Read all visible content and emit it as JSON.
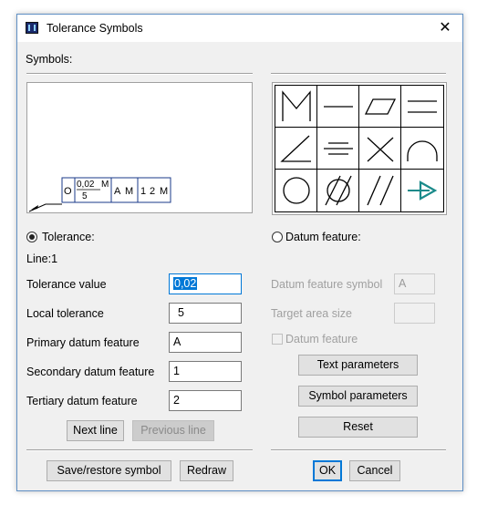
{
  "window": {
    "title": "Tolerance Symbols",
    "close_glyph": "✕"
  },
  "symbols_label": "Symbols:",
  "preview": {
    "circle_symbol": "O",
    "value_top": "0,02",
    "value_top_modifier": "M",
    "value_bottom": "5",
    "datum_a": "A",
    "datum_a_modifier": "M",
    "datum_b": "1",
    "datum_c": "2",
    "datum_c_modifier": "M"
  },
  "palette": {
    "symbols": [
      "max-material-icon",
      "straightness-icon",
      "flatness-icon",
      "parallelism-icon",
      "angularity-icon",
      "symmetry-icon",
      "position-icon",
      "profile-line-icon",
      "circularity-icon",
      "cylindricity-icon",
      "total-runout-icon",
      "circular-runout-icon"
    ],
    "arrow_color": "#1a8a8a"
  },
  "tolerance": {
    "radio_label": "Tolerance:",
    "line_label": "Line:1",
    "fields": [
      {
        "label": "Tolerance value",
        "value": "0,02"
      },
      {
        "label": "Local tolerance",
        "value": "5"
      },
      {
        "label": "Primary datum feature",
        "value": "A"
      },
      {
        "label": "Secondary datum feature",
        "value": "1"
      },
      {
        "label": "Tertiary datum feature",
        "value": "2"
      }
    ],
    "next_line": "Next line",
    "previous_line": "Previous line"
  },
  "datum": {
    "radio_label": "Datum feature:",
    "symbol_label": "Datum feature symbol",
    "symbol_value": "A",
    "target_label": "Target area size",
    "target_value": "",
    "checkbox_label": "Datum feature",
    "text_params": "Text parameters",
    "symbol_params": "Symbol parameters",
    "reset": "Reset"
  },
  "footer": {
    "save_restore": "Save/restore symbol",
    "redraw": "Redraw",
    "ok": "OK",
    "cancel": "Cancel"
  }
}
